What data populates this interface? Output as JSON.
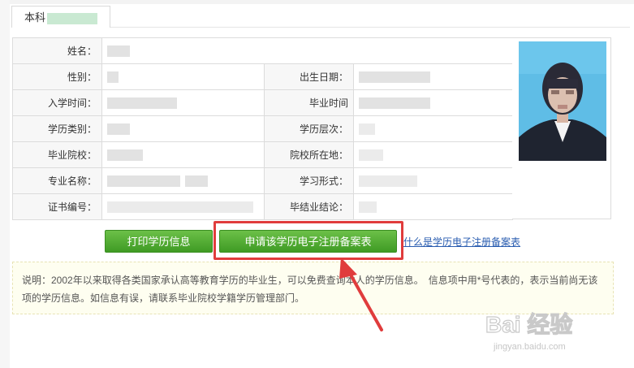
{
  "tab": {
    "label": "本科"
  },
  "table": {
    "rows": [
      {
        "label1": "姓名：",
        "label2": ""
      },
      {
        "label1": "性别：",
        "label2": "出生日期："
      },
      {
        "label1": "入学时间：",
        "label2": "毕业时间"
      },
      {
        "label1": "学历类别：",
        "label2": "学历层次："
      },
      {
        "label1": "毕业院校：",
        "label2": "院校所在地："
      },
      {
        "label1": "专业名称：",
        "label2": "学习形式："
      },
      {
        "label1": "证书编号：",
        "label2": "毕结业结论："
      }
    ]
  },
  "buttons": {
    "print": "打印学历信息",
    "apply": "申请该学历电子注册备案表",
    "help_link": "什么是学历电子注册备案表"
  },
  "note": {
    "text": "说明：2002年以来取得各类国家承认高等教育学历的毕业生，可以免费查询本人的学历信息。　信息项中用*号代表的，表示当前尚无该项的学历信息。如信息有误，请联系毕业院校学籍学历管理部门。"
  },
  "watermark": {
    "brand": "Bai 经验",
    "url": "jingyan.baidu.com"
  },
  "colors": {
    "button_green": "#4ca72e",
    "highlight_red": "#e03c3c",
    "link_blue": "#2a5db0"
  }
}
